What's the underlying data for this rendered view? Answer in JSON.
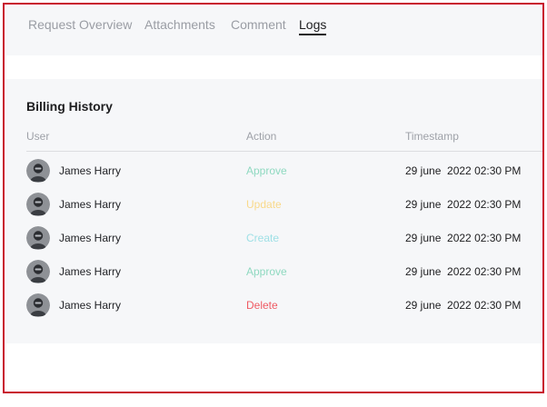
{
  "tabs": [
    {
      "label": "Request Overview",
      "active": false
    },
    {
      "label": "Attachments",
      "active": false
    },
    {
      "label": "Comment",
      "active": false
    },
    {
      "label": "Logs",
      "active": true
    }
  ],
  "billing": {
    "title": "Billing History",
    "columns": {
      "user": "User",
      "action": "Action",
      "timestamp": "Timestamp"
    },
    "rows": [
      {
        "user": "James Harry",
        "action": "Approve",
        "action_color": "#8fd9c0",
        "timestamp": "29 june  2022 02:30 PM"
      },
      {
        "user": "James Harry",
        "action": "Update",
        "action_color": "#f9d98a",
        "timestamp": "29 june  2022 02:30 PM"
      },
      {
        "user": "James Harry",
        "action": "Create",
        "action_color": "#9fe0e6",
        "timestamp": "29 june  2022 02:30 PM"
      },
      {
        "user": "James Harry",
        "action": "Approve",
        "action_color": "#8fd9c0",
        "timestamp": "29 june  2022 02:30 PM"
      },
      {
        "user": "James Harry",
        "action": "Delete",
        "action_color": "#ef5a63",
        "timestamp": "29 june  2022 02:30 PM"
      }
    ]
  },
  "colors": {
    "frame_border": "#c8102e",
    "panel_bg": "#f6f7f9",
    "text_primary": "#1d1d1f",
    "text_muted": "#9a9da4"
  }
}
